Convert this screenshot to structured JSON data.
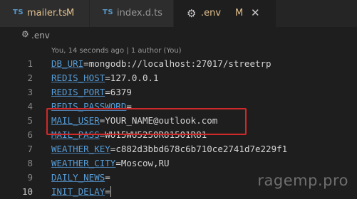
{
  "tabs": [
    {
      "badge": "TS",
      "label": "mailer.ts",
      "modified": "M"
    },
    {
      "badge": "TS",
      "label": "index.d.ts"
    },
    {
      "label": ".env",
      "modified": "M",
      "close": "✕"
    }
  ],
  "breadcrumb": {
    "label": ".env"
  },
  "editor": {
    "codelens": "You, 14 seconds ago | 1 author (You)",
    "lines": [
      {
        "num": "1",
        "key": "DB_URI",
        "value": "mongodb://localhost:27017/streetrp"
      },
      {
        "num": "2",
        "key": "REDIS_HOST",
        "value": "127.0.0.1"
      },
      {
        "num": "3",
        "key": "REDIS_PORT",
        "value": "6379"
      },
      {
        "num": "4",
        "key": "REDIS_PASSWORD",
        "value": ""
      },
      {
        "num": "5",
        "key": "MAIL_USER",
        "value": "YOUR_NAME@outlook.com"
      },
      {
        "num": "6",
        "key": "MAIL_PASS",
        "value": "WU15WU5250R81501R81"
      },
      {
        "num": "7",
        "key": "WEATHER_KEY",
        "value": "c882d3bbd678c6b710ce2741d7e229f1"
      },
      {
        "num": "8",
        "key": "WEATHER_CITY",
        "value": "Moscow,RU"
      },
      {
        "num": "9",
        "key": "DAILY_NEWS",
        "value": ""
      },
      {
        "num": "10",
        "key": "INIT_DELAY",
        "value": ""
      }
    ]
  },
  "watermark": "ragemp.pro",
  "colors": {
    "key": "#569cd6",
    "modified": "#e2c08d",
    "highlight": "#d1292a"
  }
}
